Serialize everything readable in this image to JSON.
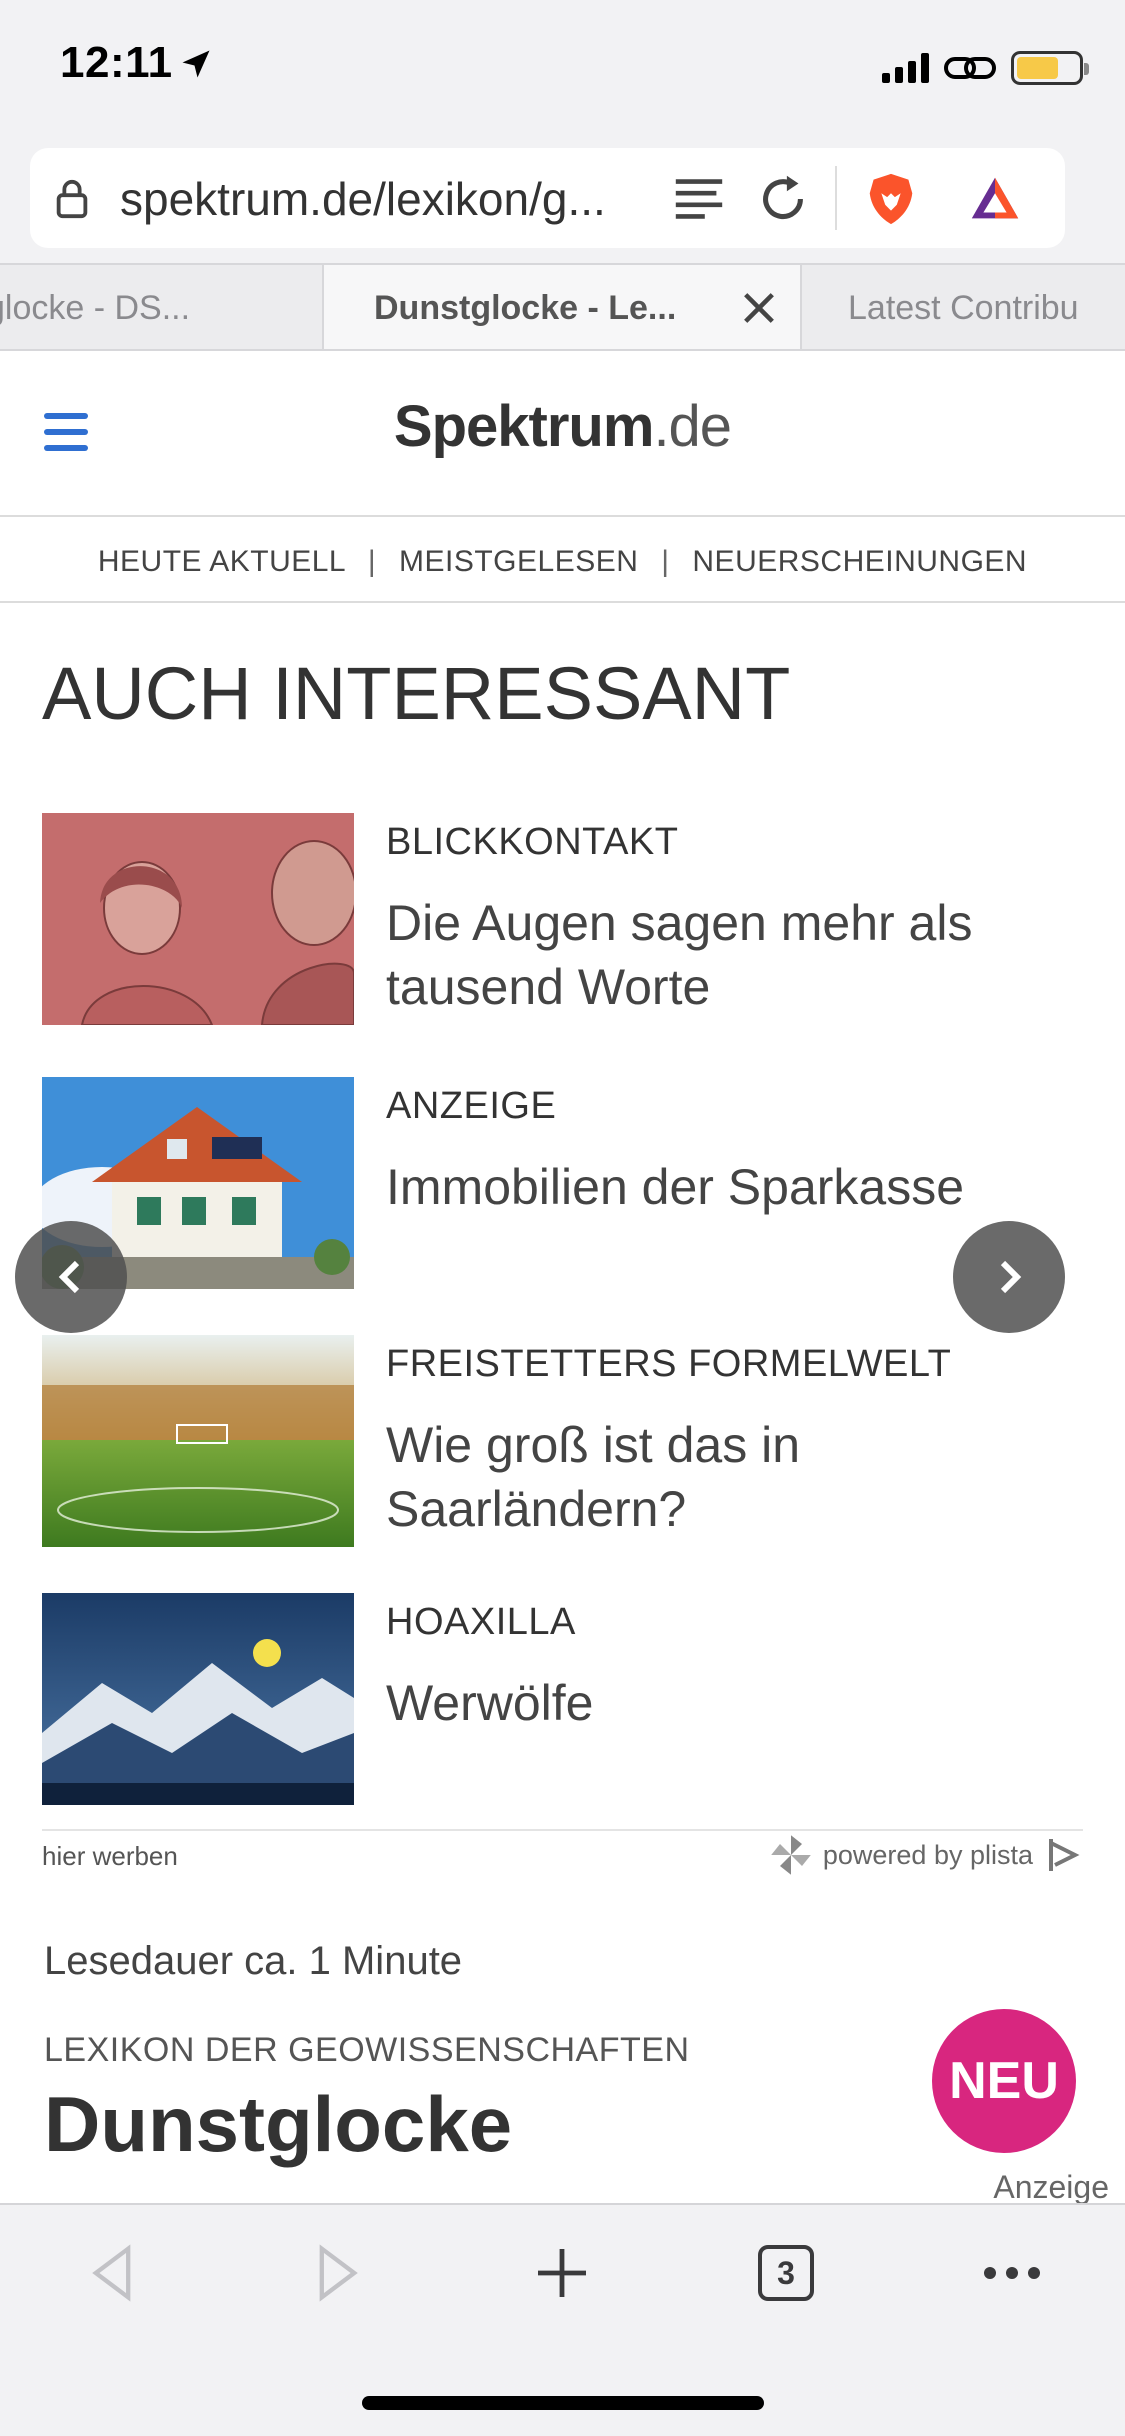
{
  "status_bar": {
    "time": "12:11",
    "battery_level": 0.68,
    "icons": [
      "location-arrow-icon",
      "signal-icon",
      "link-icon",
      "battery-charging-icon"
    ]
  },
  "url_bar": {
    "url": "spektrum.de/lexikon/g...",
    "icons": [
      "lock-icon",
      "reader-mode-icon",
      "reload-icon",
      "brave-shields-icon",
      "brave-rewards-icon"
    ]
  },
  "tabs": [
    {
      "label": "glocke - DS..."
    },
    {
      "label": "Dunstglocke - Le...",
      "active": true
    },
    {
      "label": "Latest Contribu"
    }
  ],
  "site": {
    "logo_main": "Spektrum",
    "logo_suffix": ".de",
    "subnav": [
      "HEUTE AKTUELL",
      "MEISTGELESEN",
      "NEUERSCHEINUNGEN"
    ],
    "separator": "|",
    "section_title": "AUCH INTERESSANT"
  },
  "recommendations": [
    {
      "kicker": "BLICKKONTAKT",
      "title": "Die Augen sagen mehr als tausend Worte"
    },
    {
      "kicker": "ANZEIGE",
      "title": "Immobilien der Sparkasse"
    },
    {
      "kicker": "FREISTETTERS FORMELWELT",
      "title": "Wie groß ist das in Saarländern?"
    },
    {
      "kicker": "HOAXILLA",
      "title": "Werwölfe"
    }
  ],
  "plista": {
    "hier_werben": "hier werben",
    "powered_by": "powered by plista"
  },
  "article": {
    "reading_time": "Lesedauer ca. 1 Minute",
    "category": "LEXIKON DER GEOWISSENSCHAFTEN",
    "title": "Dunstglocke",
    "badge": "NEU",
    "ad_label": "Anzeige"
  },
  "toolbar": {
    "tab_count": "3"
  },
  "colors": {
    "accent_blue": "#2f6fd1",
    "badge_pink": "#d8267f",
    "brave_orange": "#fb542b"
  }
}
